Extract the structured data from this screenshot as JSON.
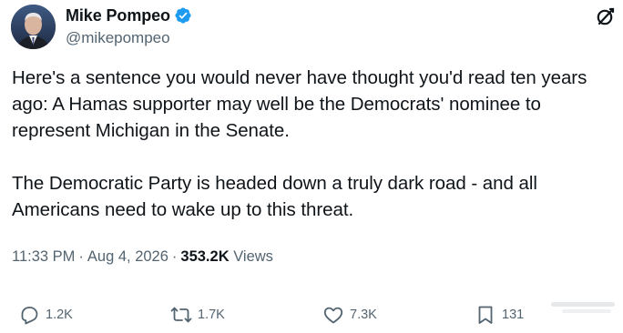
{
  "author": {
    "name": "Mike Pompeo",
    "handle": "@mikepompeo",
    "verified": true
  },
  "tweet": {
    "paragraphs": [
      "Here's a sentence you would never have thought you'd read ten years ago: A Hamas supporter may well be the Democrats' nominee to represent Michigan in the Senate.",
      "The Democratic Party is headed down a truly dark road - and all Americans need to wake up to this threat."
    ]
  },
  "meta": {
    "time": "11:33 PM",
    "date": "Aug 4, 2026",
    "views_count": "353.2K",
    "views_label": "Views"
  },
  "actions": {
    "reply_count": "1.2K",
    "retweet_count": "1.7K",
    "like_count": "7.3K",
    "bookmark_count": "131"
  },
  "icons": {
    "verified": "verified-badge-icon",
    "grok": "grok-icon",
    "reply": "reply-icon",
    "retweet": "retweet-icon",
    "like": "heart-icon",
    "bookmark": "bookmark-icon"
  },
  "colors": {
    "verified_blue": "#1d9bf0",
    "text_primary": "#0f1419",
    "text_secondary": "#536471"
  }
}
